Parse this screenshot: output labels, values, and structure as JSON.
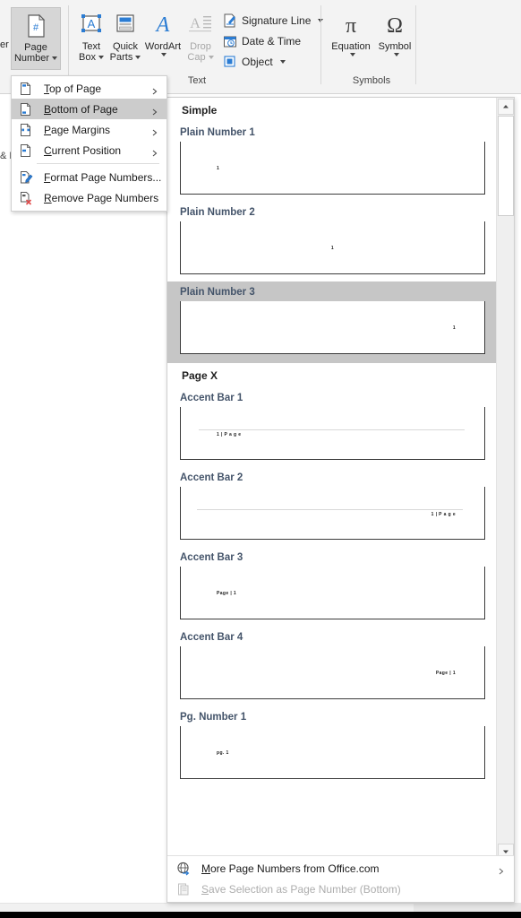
{
  "ribbon": {
    "partial_left_label": "er",
    "partial_group_label": "& F",
    "page_number_button": {
      "line1": "Page",
      "line2": "Number",
      "icon": "page-number-icon",
      "state": "active"
    },
    "buttons": [
      {
        "line1": "Text",
        "line2": "Box",
        "icon": "text-box-icon",
        "caret": true,
        "disabled": false
      },
      {
        "line1": "Quick",
        "line2": "Parts",
        "icon": "quick-parts-icon",
        "caret": true,
        "disabled": false
      },
      {
        "line1": "WordArt",
        "line2": "",
        "icon": "wordart-icon",
        "caret": true,
        "disabled": false
      },
      {
        "line1": "Drop",
        "line2": "Cap",
        "icon": "drop-cap-icon",
        "caret": true,
        "disabled": true
      },
      {
        "line1": "Equation",
        "line2": "",
        "icon": "equation-icon",
        "caret": true,
        "disabled": false
      },
      {
        "line1": "Symbol",
        "line2": "",
        "icon": "symbol-icon",
        "caret": true,
        "disabled": false
      }
    ],
    "small_buttons": [
      {
        "label": "Signature Line",
        "icon": "signature-line-icon",
        "caret": true
      },
      {
        "label": "Date & Time",
        "icon": "date-time-icon",
        "caret": false
      },
      {
        "label": "Object",
        "icon": "object-icon",
        "caret": true
      }
    ],
    "group_labels": [
      {
        "label": "Text"
      },
      {
        "label": "Symbols"
      }
    ]
  },
  "menu": {
    "items": [
      {
        "label": "Top of Page",
        "accel": "T",
        "icon": "page-top-icon",
        "submenu": true,
        "selected": false
      },
      {
        "label": "Bottom of Page",
        "accel": "B",
        "icon": "page-bottom-icon",
        "submenu": true,
        "selected": true
      },
      {
        "label": "Page Margins",
        "accel": "P",
        "icon": "page-margins-icon",
        "submenu": true,
        "selected": false
      },
      {
        "label": "Current Position",
        "accel": "C",
        "icon": "page-current-icon",
        "submenu": true,
        "selected": false
      },
      {
        "label": "Format Page Numbers...",
        "accel": "F",
        "icon": "format-page-numbers-icon",
        "submenu": false,
        "selected": false
      },
      {
        "label": "Remove Page Numbers",
        "accel": "R",
        "icon": "remove-page-numbers-icon",
        "submenu": false,
        "selected": false
      }
    ]
  },
  "gallery": {
    "sections": [
      {
        "title": "Simple",
        "items": [
          {
            "label": "Plain Number 1",
            "selected": false,
            "preview": {
              "text": "1",
              "align": "left",
              "rule": false
            }
          },
          {
            "label": "Plain Number 2",
            "selected": false,
            "preview": {
              "text": "1",
              "align": "center",
              "rule": false
            }
          },
          {
            "label": "Plain Number 3",
            "selected": true,
            "preview": {
              "text": "1",
              "align": "right",
              "rule": false
            }
          }
        ]
      },
      {
        "title": "Page X",
        "items": [
          {
            "label": "Accent Bar 1",
            "selected": false,
            "preview": {
              "text": "1 | P a g e",
              "align": "left",
              "rule": true
            }
          },
          {
            "label": "Accent Bar 2",
            "selected": false,
            "preview": {
              "text": "1 | P a g e",
              "align": "right",
              "rule": true
            }
          },
          {
            "label": "Accent Bar 3",
            "selected": false,
            "preview": {
              "text": "Page | 1",
              "align": "left",
              "rule": false
            }
          },
          {
            "label": "Accent Bar 4",
            "selected": false,
            "preview": {
              "text": "Page | 1",
              "align": "right",
              "rule": false
            }
          },
          {
            "label": "Pg. Number 1",
            "selected": false,
            "preview": {
              "text": "pg. 1",
              "align": "left",
              "rule": false
            }
          }
        ]
      }
    ],
    "footer": [
      {
        "label": "More Page Numbers from Office.com",
        "accel": "M",
        "icon": "globe-icon",
        "submenu": true,
        "disabled": false
      },
      {
        "label": "Save Selection as Page Number (Bottom)",
        "accel": "S",
        "icon": "save-selection-icon",
        "submenu": false,
        "disabled": true
      }
    ],
    "scrollbar": {
      "up_icon": "scroll-up-icon",
      "down_icon": "scroll-down-icon"
    }
  },
  "colors": {
    "accent_blue": "#2b7cd3",
    "item_label": "#44546a",
    "selection_gray": "#c6c6c6",
    "menu_highlight": "#cccccc",
    "ribbon_bg": "#f3f3f3"
  }
}
